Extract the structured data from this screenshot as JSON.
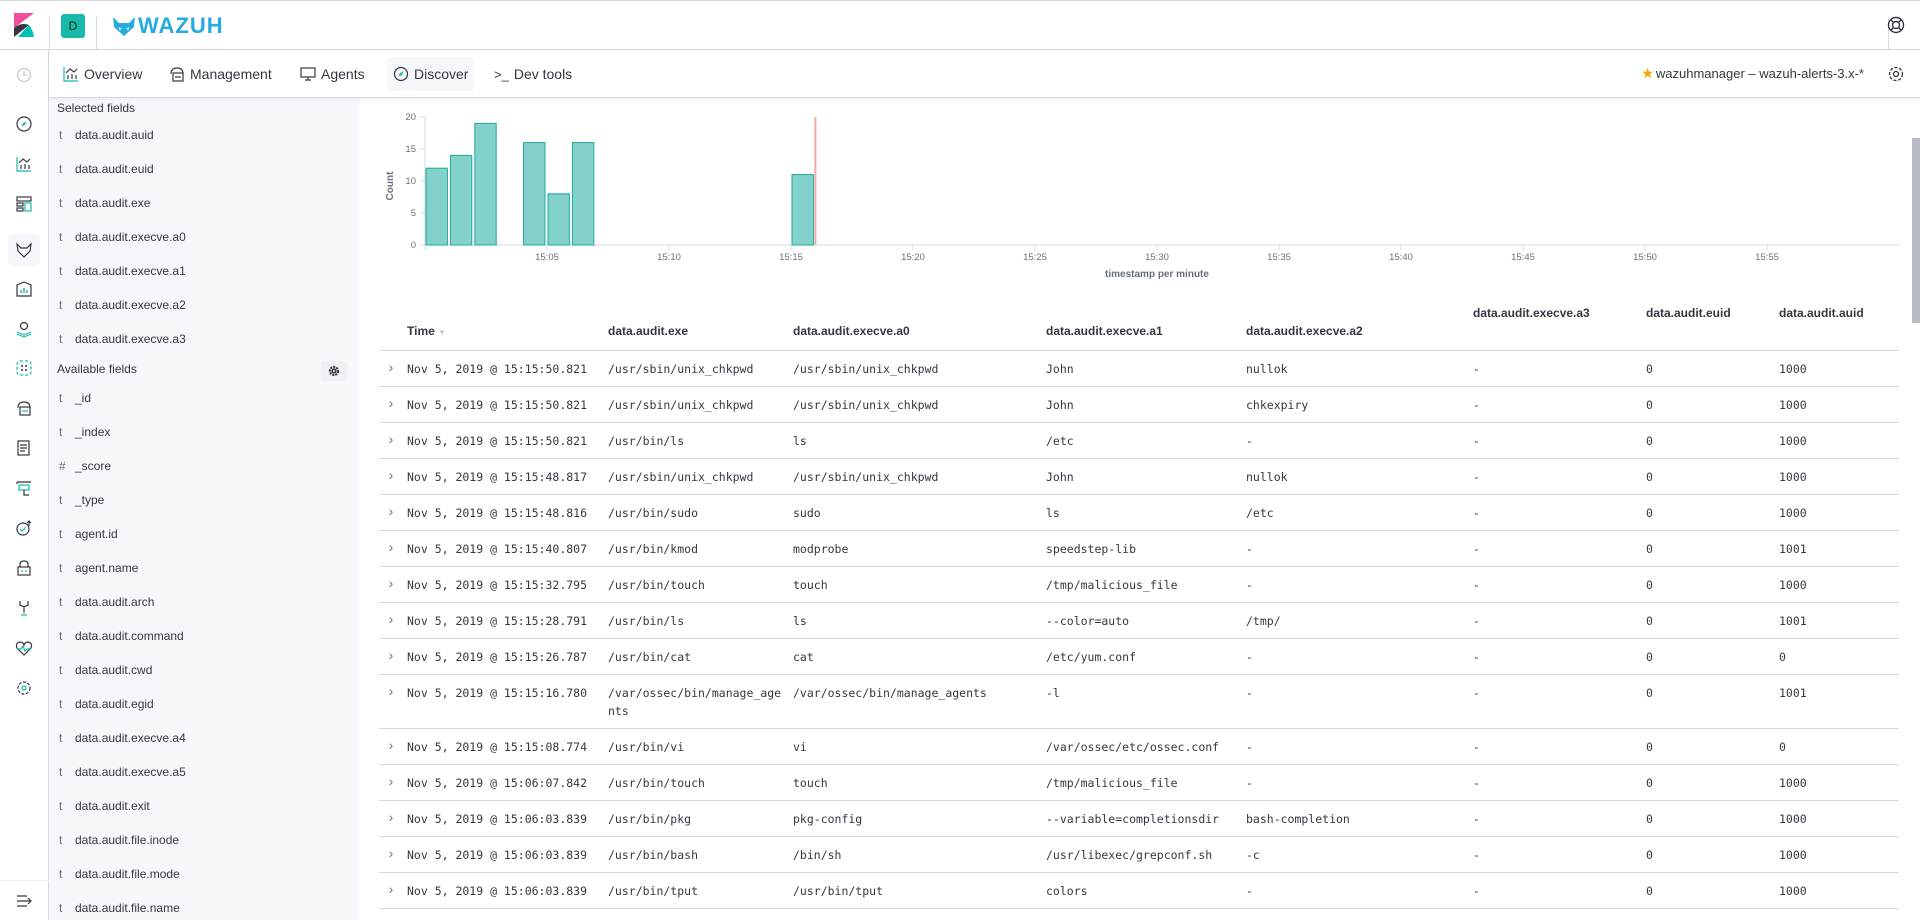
{
  "topbar": {
    "space_initial": "D",
    "app_name": "WAZUH"
  },
  "nav": {
    "items": [
      {
        "label": "Overview",
        "icon": "chart-icon"
      },
      {
        "label": "Management",
        "icon": "cloud-server-icon"
      },
      {
        "label": "Agents",
        "icon": "monitor-icon"
      },
      {
        "label": "Discover",
        "icon": "compass-icon",
        "active": true
      },
      {
        "label": "Dev tools",
        "icon": "console-icon"
      }
    ],
    "index_pattern": "wazuhmanager – wazuh-alerts-3.x-*"
  },
  "sidebar": {
    "selected_header": "Selected fields",
    "selected_fields": [
      {
        "type": "t",
        "name": "data.audit.auid"
      },
      {
        "type": "t",
        "name": "data.audit.euid"
      },
      {
        "type": "t",
        "name": "data.audit.exe"
      },
      {
        "type": "t",
        "name": "data.audit.execve.a0"
      },
      {
        "type": "t",
        "name": "data.audit.execve.a1"
      },
      {
        "type": "t",
        "name": "data.audit.execve.a2"
      },
      {
        "type": "t",
        "name": "data.audit.execve.a3"
      }
    ],
    "available_header": "Available fields",
    "available_fields": [
      {
        "type": "t",
        "name": "_id"
      },
      {
        "type": "t",
        "name": "_index"
      },
      {
        "type": "#",
        "name": "_score"
      },
      {
        "type": "t",
        "name": "_type"
      },
      {
        "type": "t",
        "name": "agent.id"
      },
      {
        "type": "t",
        "name": "agent.name"
      },
      {
        "type": "t",
        "name": "data.audit.arch"
      },
      {
        "type": "t",
        "name": "data.audit.command"
      },
      {
        "type": "t",
        "name": "data.audit.cwd"
      },
      {
        "type": "t",
        "name": "data.audit.egid"
      },
      {
        "type": "t",
        "name": "data.audit.execve.a4"
      },
      {
        "type": "t",
        "name": "data.audit.execve.a5"
      },
      {
        "type": "t",
        "name": "data.audit.exit"
      },
      {
        "type": "t",
        "name": "data.audit.file.inode"
      },
      {
        "type": "t",
        "name": "data.audit.file.mode"
      },
      {
        "type": "t",
        "name": "data.audit.file.name"
      }
    ]
  },
  "colors": {
    "bar_fill": "#82d1cb",
    "bar_stroke": "#1fa99b",
    "now_marker": "#f0a8a8",
    "accent": "#18b9a8"
  },
  "chart_data": {
    "type": "bar",
    "title": "",
    "xlabel": "timestamp per minute",
    "ylabel": "Count",
    "ylim": [
      0,
      20
    ],
    "yticks": [
      0,
      5,
      10,
      15,
      20
    ],
    "xlim_minutes": [
      "15:00",
      "16:00"
    ],
    "xticks": [
      "15:05",
      "15:10",
      "15:15",
      "15:20",
      "15:25",
      "15:30",
      "15:35",
      "15:40",
      "15:45",
      "15:50",
      "15:55"
    ],
    "categories": [
      "15:00",
      "15:01",
      "15:02",
      "15:04",
      "15:05",
      "15:06",
      "15:15"
    ],
    "values": [
      12,
      14,
      19,
      16,
      8,
      16,
      11
    ],
    "now_marker": "15:16",
    "grid": false,
    "legend": "none"
  },
  "table": {
    "columns": [
      "Time",
      "data.audit.exe",
      "data.audit.execve.a0",
      "data.audit.execve.a1",
      "data.audit.execve.a2",
      "data.audit.execve.a3",
      "data.audit.euid",
      "data.audit.auid"
    ],
    "rows": [
      [
        "Nov 5, 2019 @ 15:15:50.821",
        "/usr/sbin/unix_chkpwd",
        "/usr/sbin/unix_chkpwd",
        "John",
        "nullok",
        "-",
        "0",
        "1000"
      ],
      [
        "Nov 5, 2019 @ 15:15:50.821",
        "/usr/sbin/unix_chkpwd",
        "/usr/sbin/unix_chkpwd",
        "John",
        "chkexpiry",
        "-",
        "0",
        "1000"
      ],
      [
        "Nov 5, 2019 @ 15:15:50.821",
        "/usr/bin/ls",
        "ls",
        "/etc",
        " -",
        "-",
        "0",
        "1000"
      ],
      [
        "Nov 5, 2019 @ 15:15:48.817",
        "/usr/sbin/unix_chkpwd",
        "/usr/sbin/unix_chkpwd",
        "John",
        "nullok",
        "-",
        "0",
        "1000"
      ],
      [
        "Nov 5, 2019 @ 15:15:48.816",
        "/usr/bin/sudo",
        "sudo",
        "ls",
        "/etc",
        "-",
        "0",
        "1000"
      ],
      [
        "Nov 5, 2019 @ 15:15:40.807",
        "/usr/bin/kmod",
        "modprobe",
        "speedstep-lib",
        " -",
        "-",
        "0",
        "1001"
      ],
      [
        "Nov 5, 2019 @ 15:15:32.795",
        "/usr/bin/touch",
        "touch",
        "/tmp/malicious_file",
        " -",
        "-",
        "0",
        "1000"
      ],
      [
        "Nov 5, 2019 @ 15:15:28.791",
        "/usr/bin/ls",
        "ls",
        "--color=auto",
        "/tmp/",
        "-",
        "0",
        "1001"
      ],
      [
        "Nov 5, 2019 @ 15:15:26.787",
        "/usr/bin/cat",
        "cat",
        "/etc/yum.conf",
        " -",
        "-",
        "0",
        "0"
      ],
      [
        "Nov 5, 2019 @ 15:15:16.780",
        "/var/ossec/bin/manage_agents",
        "/var/ossec/bin/manage_agents",
        "-l",
        " -",
        "-",
        "0",
        "1001"
      ],
      [
        "Nov 5, 2019 @ 15:15:08.774",
        "/usr/bin/vi",
        "vi",
        "/var/ossec/etc/ossec.conf",
        " -",
        "-",
        "0",
        "0"
      ],
      [
        "Nov 5, 2019 @ 15:06:07.842",
        "/usr/bin/touch",
        "touch",
        "/tmp/malicious_file",
        " -",
        "-",
        "0",
        "1000"
      ],
      [
        "Nov 5, 2019 @ 15:06:03.839",
        "/usr/bin/pkg",
        "pkg-config",
        "--variable=completionsdir",
        "bash-completion",
        "-",
        "0",
        "1000"
      ],
      [
        "Nov 5, 2019 @ 15:06:03.839",
        "/usr/bin/bash",
        "/bin/sh",
        "/usr/libexec/grepconf.sh",
        "-c",
        "-",
        "0",
        "1000"
      ],
      [
        "Nov 5, 2019 @ 15:06:03.839",
        "/usr/bin/tput",
        "/usr/bin/tput",
        "colors",
        " -",
        "-",
        "0",
        "1000"
      ]
    ]
  }
}
